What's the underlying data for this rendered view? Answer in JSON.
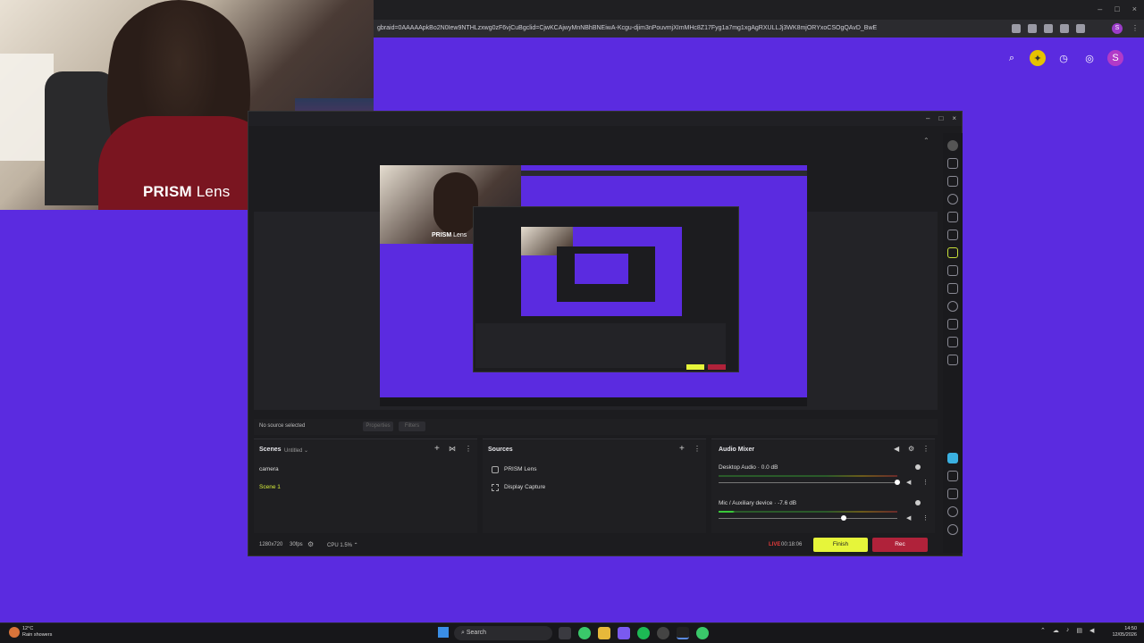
{
  "browser": {
    "url": "gbraid=0AAAAApkBo2N0Iew9NTHLzxwg0zF6vjCuBgclid=CjwKCAjwyMnNBhBNEiwA-Kcgu-djim3nPouvmjXImMHc8Z17Fyg1a7mg1xgAgRXULLJj3WK8mjORYxoCSOgQAvD_BwE",
    "window_controls": [
      "–",
      "□",
      "×"
    ],
    "profile_initial": "S"
  },
  "camera_overlay": {
    "label_bold": "PRISM",
    "label_rest": " Lens"
  },
  "preview_overlay": {
    "label_bold": "PRISM",
    "label_rest": " Lens"
  },
  "obs": {
    "no_source": "No source selected",
    "properties_btn": "Properties",
    "filters_btn": "Filters",
    "scenes": {
      "title": "Scenes",
      "collection": "Untitled",
      "items": [
        "camera",
        "Scene 1"
      ]
    },
    "sources": {
      "title": "Sources",
      "items": [
        "PRISM Lens",
        "Display Capture"
      ]
    },
    "mixer": {
      "title": "Audio Mixer",
      "channels": [
        {
          "name": "Desktop Audio",
          "db": "0.0 dB"
        },
        {
          "name": "Mic / Auxiliary device",
          "db": "-7.6 dB"
        }
      ]
    },
    "status": {
      "resolution": "1280x720",
      "fps": "30fps",
      "cpu": "CPU 1.5%",
      "live": "LIVE",
      "time": "00:18:06",
      "finish": "Finish",
      "rec": "Rec"
    }
  },
  "taskbar": {
    "weather_temp": "12°C",
    "weather_desc": "Rain showers",
    "search": "Search",
    "clock_time": "14:50",
    "clock_date": "12/05/2026"
  },
  "colors": {
    "purple": "#5b2be0",
    "finish": "#e6f53a",
    "rec": "#b0223a",
    "scene_active": "#d9ef3a"
  }
}
